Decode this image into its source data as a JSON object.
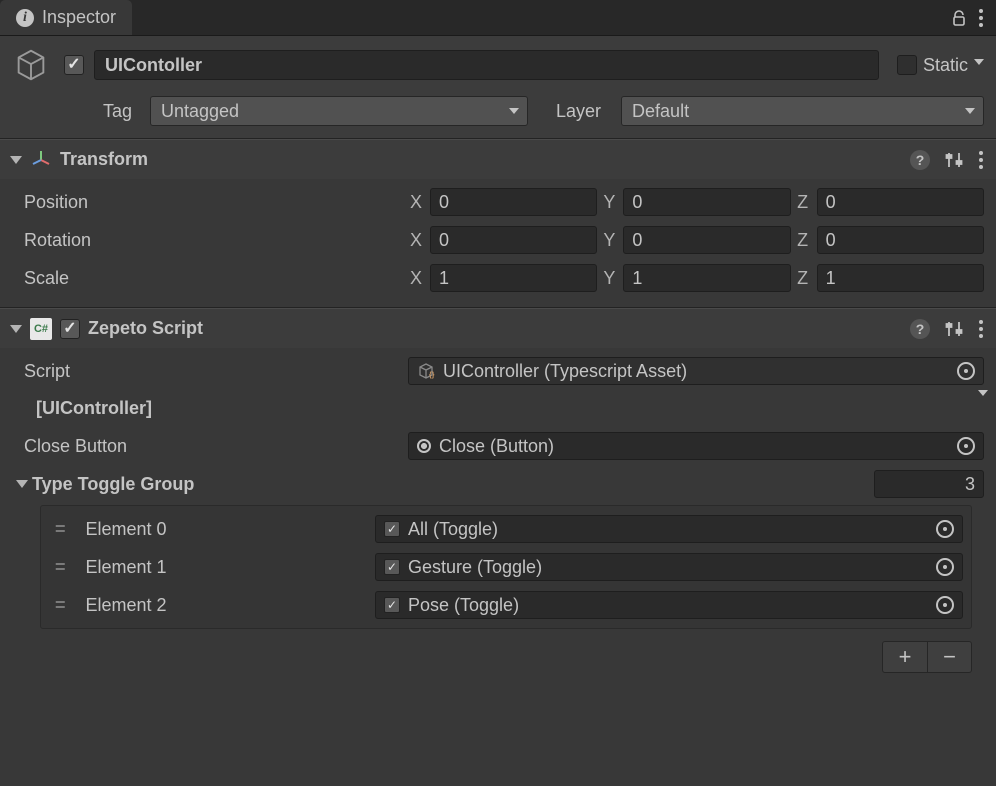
{
  "tab": {
    "title": "Inspector"
  },
  "header": {
    "name": "UIContoller",
    "static_label": "Static",
    "tag_label": "Tag",
    "tag_value": "Untagged",
    "layer_label": "Layer",
    "layer_value": "Default"
  },
  "transform": {
    "title": "Transform",
    "rows": [
      {
        "label": "Position",
        "x": "0",
        "y": "0",
        "z": "0"
      },
      {
        "label": "Rotation",
        "x": "0",
        "y": "0",
        "z": "0"
      },
      {
        "label": "Scale",
        "x": "1",
        "y": "1",
        "z": "1"
      }
    ],
    "axis": {
      "x": "X",
      "y": "Y",
      "z": "Z"
    }
  },
  "zepeto": {
    "title": "Zepeto Script",
    "script_label": "Script",
    "script_value": "UIController (Typescript Asset)",
    "section": "[UIController]",
    "close_label": "Close Button",
    "close_value": "Close (Button)",
    "toggle_label": "Type Toggle Group",
    "toggle_count": "3",
    "elements": [
      {
        "label": "Element 0",
        "value": "All  (Toggle)"
      },
      {
        "label": "Element 1",
        "value": "Gesture (Toggle)"
      },
      {
        "label": "Element 2",
        "value": "Pose (Toggle)"
      }
    ]
  },
  "icons": {
    "plus": "+",
    "minus": "−",
    "help": "?"
  }
}
